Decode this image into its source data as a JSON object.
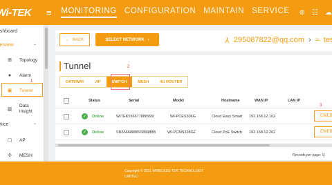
{
  "header": {
    "logo": "Wi-TEK",
    "nav": [
      "MONITORING",
      "CONFIGURATION",
      "MAINTAIN",
      "SERVICE"
    ],
    "active_nav": "MONITORING",
    "icons": [
      "link-icon",
      "grid-icon",
      "cloud-icon"
    ]
  },
  "sidebar": {
    "dashboard": "ashboard",
    "overview": "verview",
    "device": "evice",
    "items": [
      {
        "label": "Topology",
        "icon": "topology-icon"
      },
      {
        "label": "Alarm",
        "icon": "bell-icon"
      },
      {
        "label": "Tunnel",
        "icon": "tunnel-icon",
        "active": true
      },
      {
        "label": "Data insight",
        "icon": "chart-icon"
      },
      {
        "label": "AP",
        "icon": "ap-icon"
      },
      {
        "label": "MESH",
        "icon": "mesh-icon"
      }
    ]
  },
  "toolbar": {
    "back_label": "BACK",
    "select_network_label": "SELECT NETWORK",
    "account": "295087822@qq.com",
    "network": "tes"
  },
  "panel": {
    "title": "Tunnel",
    "tabs": [
      "GATEWAY",
      "AP",
      "SWITCH",
      "MESH",
      "4G ROUTER"
    ],
    "active_tab": "SWITCH"
  },
  "annotations": {
    "one": "1",
    "two": "2",
    "three": "3"
  },
  "table": {
    "columns": [
      "Status",
      "Serial",
      "Model",
      "Hostname",
      "WAN IP",
      "LAN IP"
    ],
    "rows": [
      {
        "status": "Online",
        "serial": "WITEK556677888999",
        "model": "WI-PCES306G",
        "hostname": "Cloud Easy Smart",
        "wan_ip": "192.168.12.102",
        "lan_ip": "",
        "action": "EWEB"
      },
      {
        "status": "Online",
        "serial": "SN556688889389988B",
        "model": "WI-PCMS328GF",
        "hostname": "Cloud PoE Switch",
        "wan_ip": "192.168.12.202",
        "lan_ip": "",
        "action": "EWEB"
      }
    ]
  },
  "pagination": {
    "label": "Records per page:",
    "value": "1("
  },
  "footer": {
    "line1": "Copyright © 2021 WIRELESS-TEK TECHNOLOGY",
    "line2": "LIMITED"
  },
  "colors": {
    "accent": "#f39c12",
    "online": "#4caf50",
    "annotation": "#e53935"
  }
}
